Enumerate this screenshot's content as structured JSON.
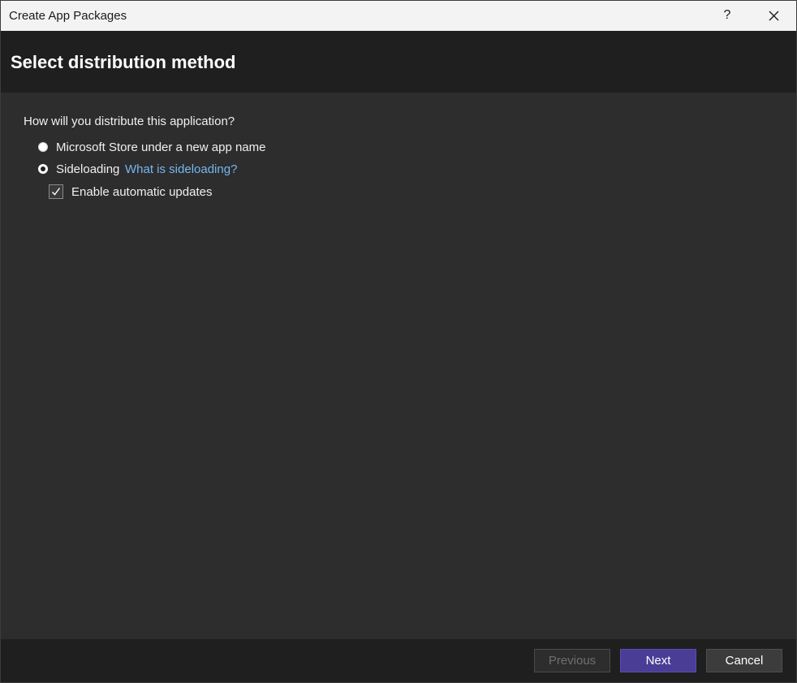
{
  "window": {
    "title": "Create App Packages",
    "help_label": "?",
    "close_icon": "close-icon"
  },
  "header": {
    "title": "Select distribution method"
  },
  "content": {
    "question": "How will you distribute this application?",
    "options": [
      {
        "label": "Microsoft Store under a new app name",
        "selected": false
      },
      {
        "label": "Sideloading",
        "selected": true,
        "link_text": "What is sideloading?"
      }
    ],
    "auto_updates": {
      "label": "Enable automatic updates",
      "checked": true
    }
  },
  "footer": {
    "previous_label": "Previous",
    "previous_enabled": false,
    "next_label": "Next",
    "cancel_label": "Cancel"
  },
  "colors": {
    "accent": "#4a3d96",
    "link": "#75b6f0",
    "background": "#2d2d2d",
    "header_background": "#1f1f1f"
  }
}
